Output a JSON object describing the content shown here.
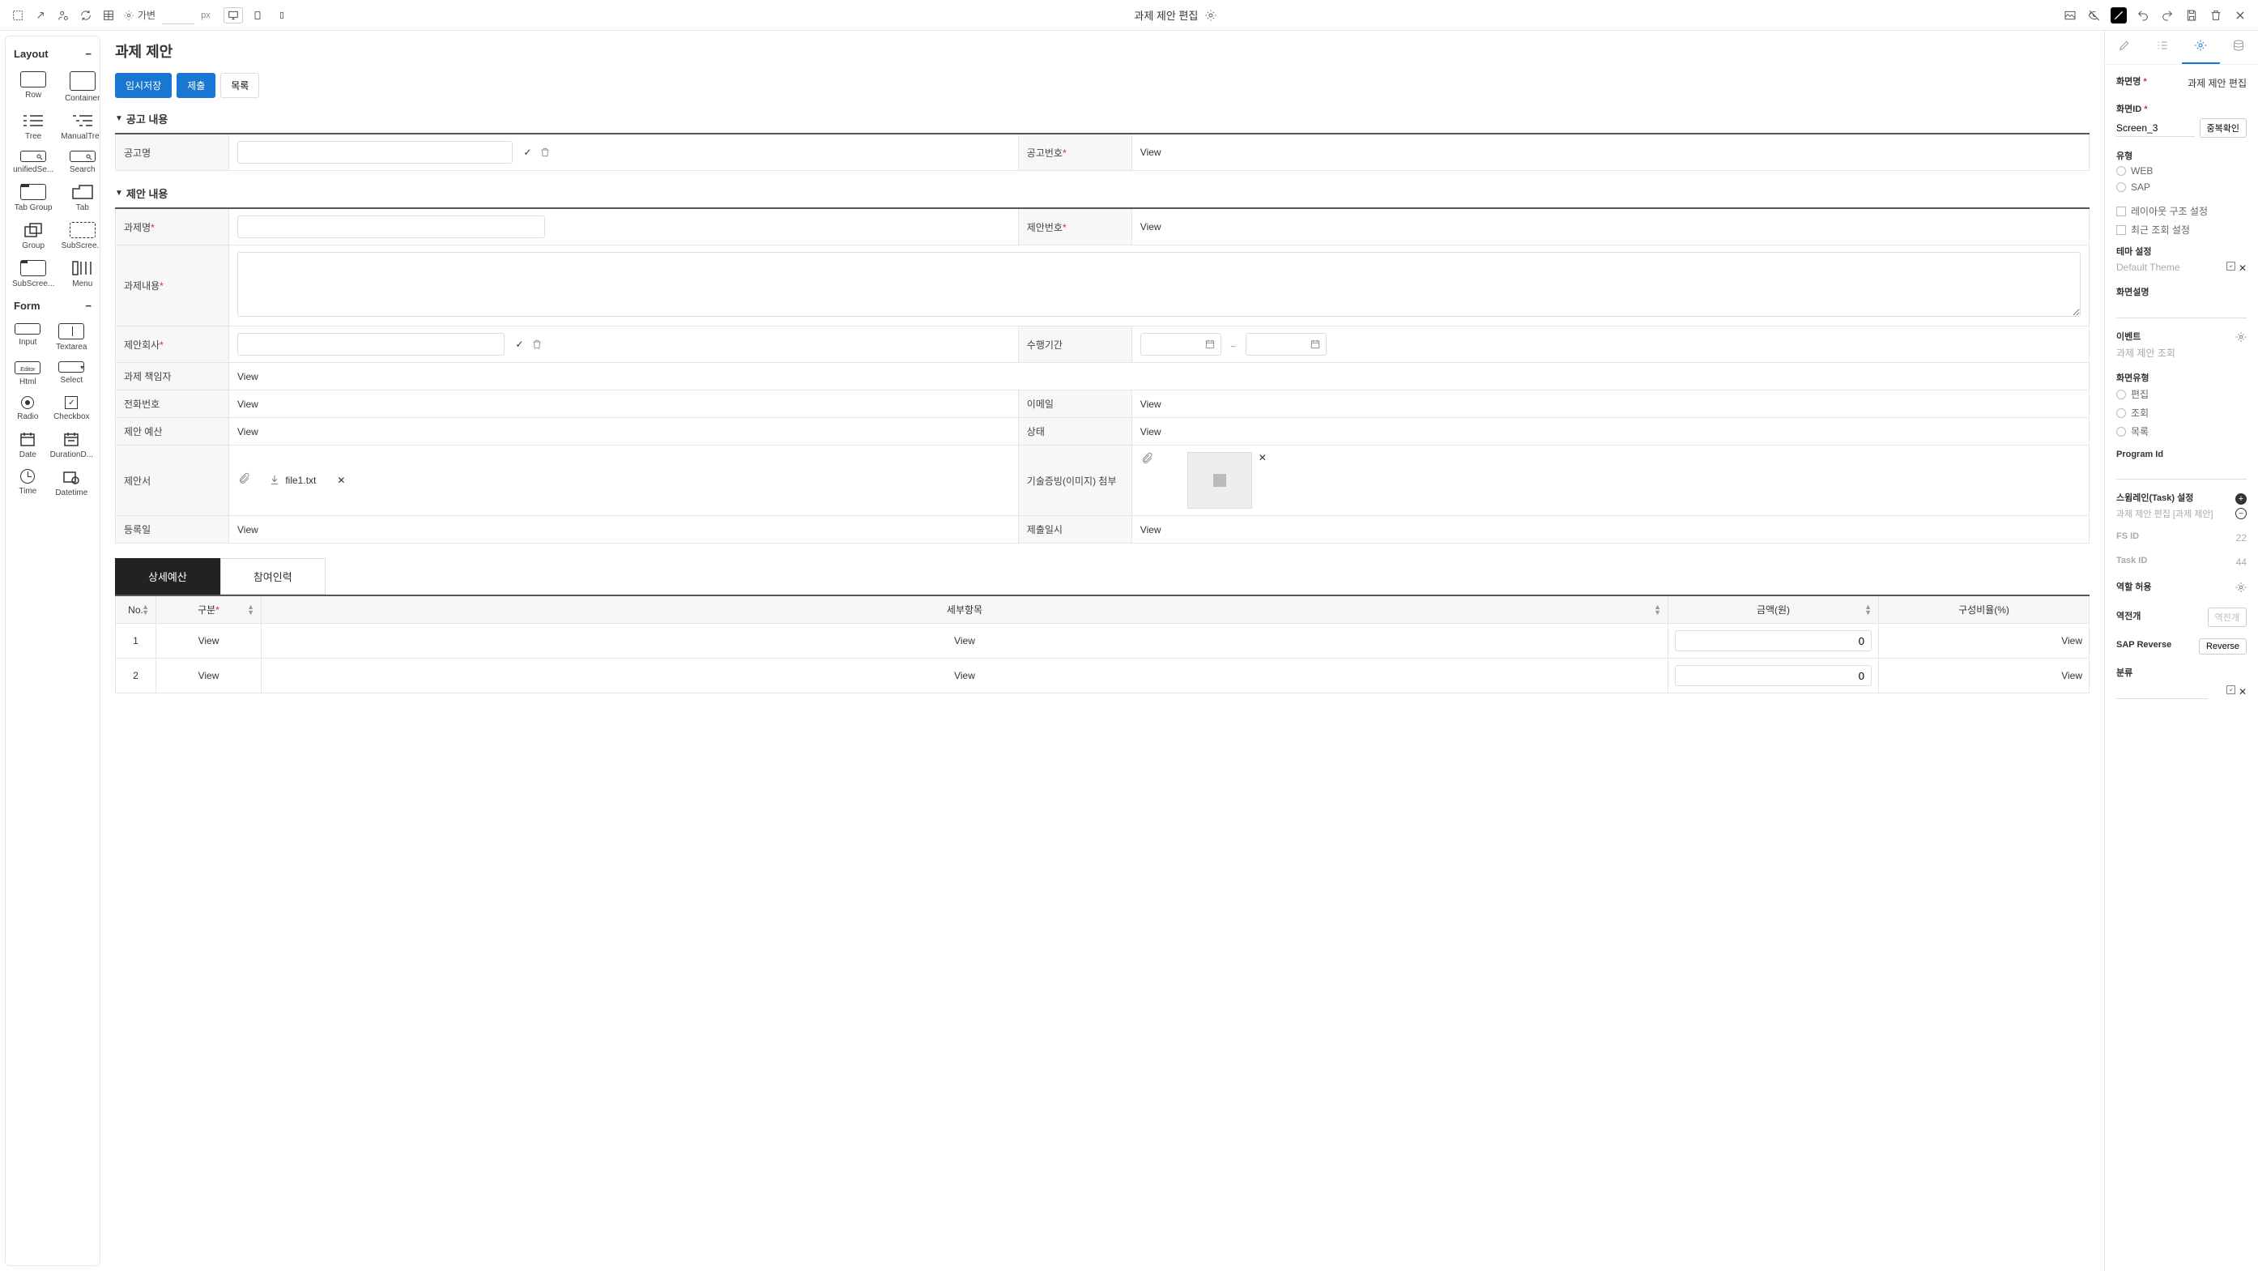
{
  "topbar": {
    "title": "과제 제안 편집",
    "responsive_label": "가변",
    "px_unit": "px"
  },
  "left_panel": {
    "sections": [
      {
        "title": "Layout",
        "items": [
          "Row",
          "Container",
          "Tree",
          "ManualTree",
          "unifiedSe...",
          "Search",
          "Tab Group",
          "Tab",
          "Group",
          "SubScree...",
          "SubScree...",
          "Menu"
        ]
      },
      {
        "title": "Form",
        "items": [
          "Input",
          "Textarea",
          "Html",
          "Select",
          "Radio",
          "Checkbox",
          "Date",
          "DurationD...",
          "Time",
          "Datetime"
        ]
      }
    ]
  },
  "canvas": {
    "page_title": "과제 제안",
    "buttons": {
      "save_draft": "임시저장",
      "submit": "제출",
      "list": "목록"
    },
    "section1": {
      "title": "공고 내용",
      "fields": {
        "notice_name": "공고명",
        "notice_no": "공고번호"
      },
      "view": "View"
    },
    "section2": {
      "title": "제안 내용",
      "fields": {
        "task_name": "과제명",
        "proposal_no": "제안번호",
        "task_content": "과제내용",
        "proposer": "제안회사",
        "period": "수행기간",
        "manager": "과제 책임자",
        "phone": "전화번호",
        "email": "이메일",
        "budget": "제안 예산",
        "status": "상태",
        "proposal_doc": "제안서",
        "tech_attach": "기술증빙(이미지) 첨부",
        "reg_date": "등록일",
        "submit_date": "제출일시"
      },
      "view": "View",
      "period_sep": "~",
      "file_name": "file1.txt"
    },
    "tabs": {
      "budget": "상세예산",
      "members": "참여인력"
    },
    "table": {
      "headers": {
        "no": "No.",
        "type": "구분",
        "detail": "세부항목",
        "amount": "금액(원)",
        "ratio": "구성비율(%)"
      },
      "rows": [
        {
          "no": "1",
          "type": "View",
          "detail": "View",
          "amount": "0",
          "ratio": "View"
        },
        {
          "no": "2",
          "type": "View",
          "detail": "View",
          "amount": "0",
          "ratio": "View"
        }
      ]
    }
  },
  "right_panel": {
    "screen_name_label": "화면명",
    "screen_name_value": "과제 제안 편집",
    "screen_id_label": "화면ID",
    "screen_id_value": "Screen_3",
    "dup_check": "중복확인",
    "type_label": "유형",
    "type_options": {
      "web": "WEB",
      "sap": "SAP"
    },
    "layout_check": "레이아웃 구조 설정",
    "recent_check": "최근 조회 설정",
    "theme_label": "테마 설정",
    "theme_value": "Default Theme",
    "desc_label": "화면설명",
    "event_label": "이벤트",
    "event_value": "과제 제안 조회",
    "screen_type_label": "화면유형",
    "screen_type_options": {
      "edit": "편집",
      "view": "조회",
      "list": "목록"
    },
    "program_id_label": "Program Id",
    "swimlane_label": "스윔레인(Task) 설정",
    "swimlane_value": "과제 제안 편집 [과제 제안]",
    "fs_id_label": "FS ID",
    "fs_id_value": "22",
    "task_id_label": "Task ID",
    "task_id_value": "44",
    "role_label": "역할 허용",
    "reverse_label": "역전개",
    "reverse_btn": "역전개",
    "sap_reverse_label": "SAP Reverse",
    "sap_reverse_btn": "Reverse",
    "category_label": "분류"
  }
}
